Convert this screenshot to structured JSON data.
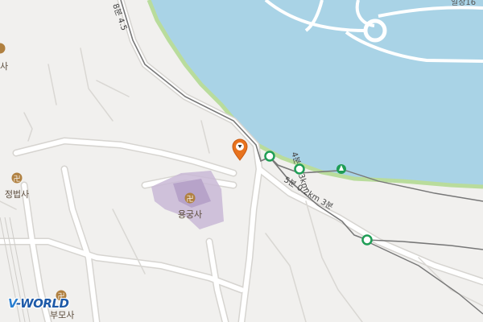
{
  "map": {
    "places": [
      {
        "name": "정법사",
        "icon": "temple-icon"
      },
      {
        "name": "용궁사",
        "icon": "temple-icon"
      },
      {
        "name": "",
        "icon": "temple-icon"
      },
      {
        "name": "",
        "icon": "temple-icon"
      }
    ],
    "partial_labels": {
      "left_top": "사",
      "bottom": "부모사",
      "top_right": "일장16"
    },
    "route": {
      "label_main": "5분 0.2km 3분",
      "label_upper": "4분 0.3km",
      "label_top": "8분 4.5"
    },
    "marker": {
      "icon": "location-pin-icon",
      "color": "#e8731e"
    },
    "route_points": [
      {
        "icon": "route-node-icon",
        "color": "#1f9d55"
      },
      {
        "icon": "route-node-icon",
        "color": "#1f9d55"
      },
      {
        "icon": "route-node-icon",
        "color": "#1f9d55"
      },
      {
        "icon": "route-end-icon",
        "color": "#1f9d55"
      }
    ],
    "colors": {
      "water": "#a9d3e6",
      "land": "#f1f0ee",
      "road": "#ffffff",
      "road_edge": "#d6d4d0",
      "shore": "#b9dc9c",
      "temple_area": "#c9b8d6",
      "route": "#777777"
    },
    "logo": {
      "prefix": "V",
      "text": "-WORLD"
    }
  }
}
